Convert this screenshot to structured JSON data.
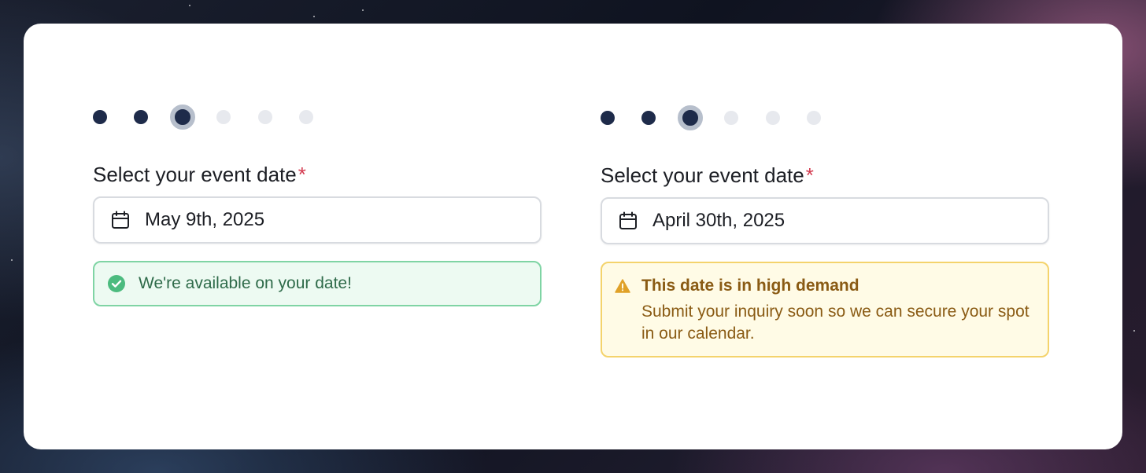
{
  "left_panel": {
    "steps": [
      "done",
      "done",
      "current",
      "todo",
      "todo",
      "todo"
    ],
    "label": "Select your event date",
    "required_mark": "*",
    "date_value": "May 9th, 2025",
    "status": {
      "type": "success",
      "message": "We're available on your date!",
      "icon": "check-circle-icon"
    }
  },
  "right_panel": {
    "steps": [
      "done",
      "done",
      "current",
      "todo",
      "todo",
      "todo"
    ],
    "label": "Select your event date",
    "required_mark": "*",
    "date_value": "April 30th, 2025",
    "status": {
      "type": "warning",
      "title": "This date is in high demand",
      "message": "Submit your inquiry soon so we can secure your spot in our calendar.",
      "icon": "warning-triangle-icon"
    }
  },
  "colors": {
    "step_done": "#1e2b4a",
    "step_todo": "#e7e9ee",
    "required": "#d33a4f",
    "success_bg": "#edfaf2",
    "success_border": "#7fd4a4",
    "warning_bg": "#fffbe6",
    "warning_border": "#f4d36c"
  }
}
